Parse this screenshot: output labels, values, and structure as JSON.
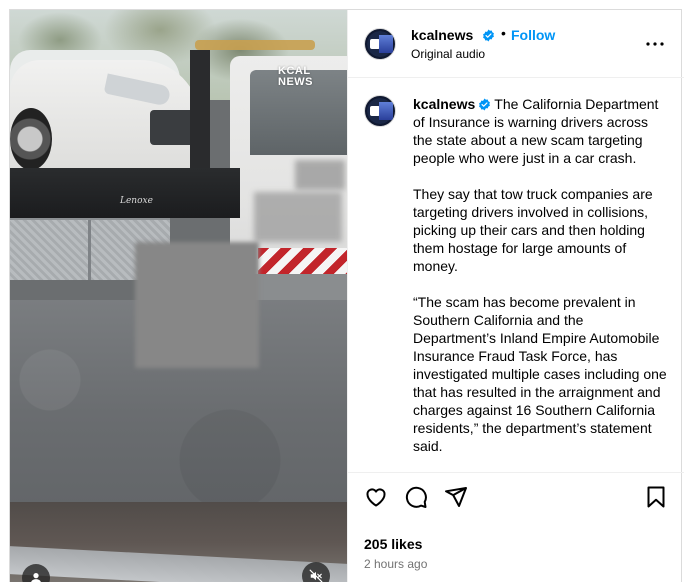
{
  "media": {
    "watermark_line1": "KCAL",
    "watermark_line2": "NEWS",
    "truck_decal": "Lenoxe"
  },
  "header": {
    "username": "kcalnews",
    "separator": "•",
    "follow_label": "Follow",
    "audio_label": "Original audio"
  },
  "caption": {
    "username": "kcalnews",
    "paragraphs": [
      "The California Department of Insurance is warning drivers across the state about a new scam targeting people who were just in a car crash.",
      "They say that tow truck companies are targeting drivers involved in collisions, picking up their cars and then holding them hostage for large amounts of money.",
      "“The scam has become prevalent in Southern California and the Department’s Inland Empire Automobile Insurance Fraud Task Force, has investigated multiple cases including one that has resulted in the arraignment and charges against 16 Southern California residents,” the department’s statement said."
    ]
  },
  "footer": {
    "likes": "205 likes",
    "timestamp": "2 hours ago"
  },
  "icons": {
    "verified": "verified-badge-icon",
    "more": "more-options-icon",
    "like": "heart-icon",
    "comment": "comment-icon",
    "share": "share-icon",
    "save": "bookmark-icon",
    "user": "user-tag-icon",
    "mute": "speaker-muted-icon"
  },
  "colors": {
    "follow_blue": "#0095f6",
    "verified_blue": "#0095f6",
    "border": "#dbdbdb",
    "muted_text": "#737373"
  }
}
